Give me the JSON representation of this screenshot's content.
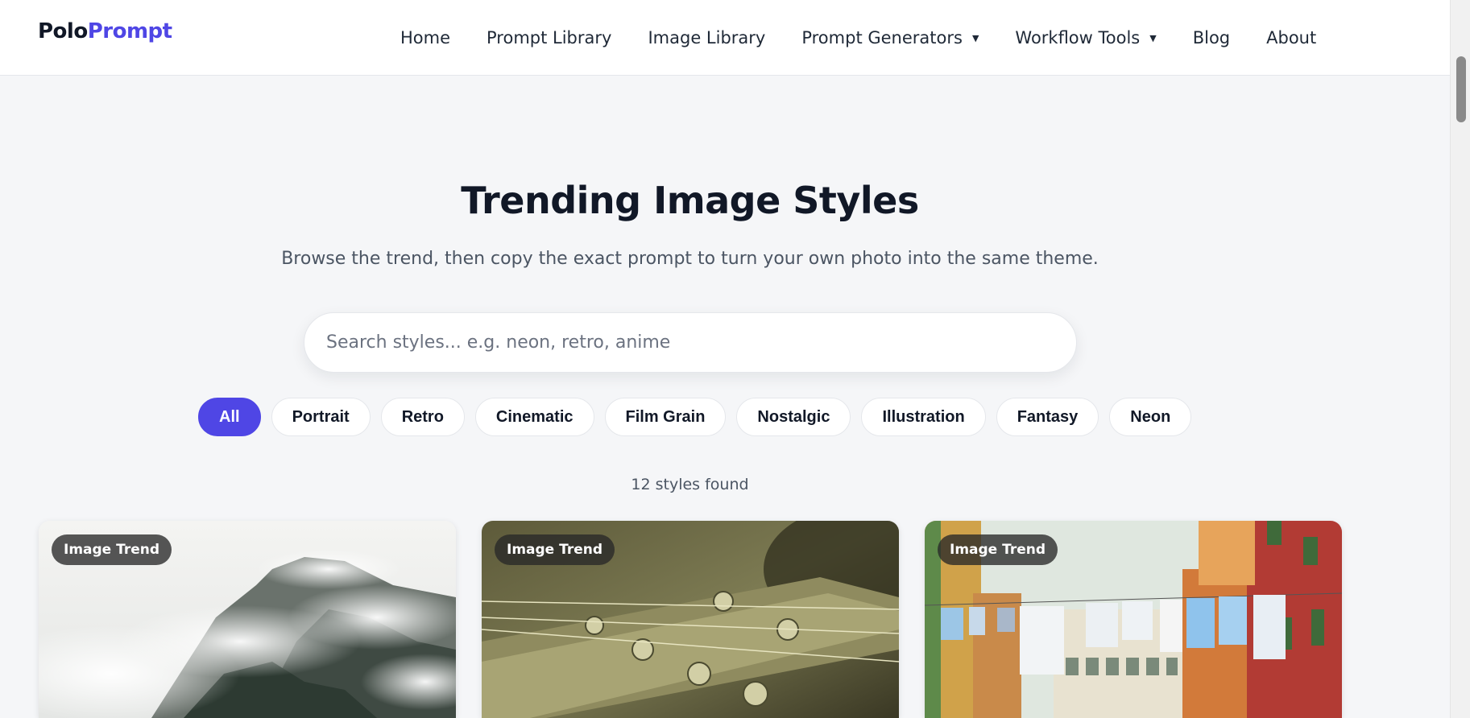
{
  "brand": {
    "part1": "Polo",
    "part2": "Prompt"
  },
  "nav": [
    {
      "label": "Home",
      "dropdown": false
    },
    {
      "label": "Prompt Library",
      "dropdown": false
    },
    {
      "label": "Image Library",
      "dropdown": false
    },
    {
      "label": "Prompt Generators",
      "dropdown": true
    },
    {
      "label": "Workflow Tools",
      "dropdown": true
    },
    {
      "label": "Blog",
      "dropdown": false
    },
    {
      "label": "About",
      "dropdown": false
    }
  ],
  "hero": {
    "title": "Trending Image Styles",
    "subtitle": "Browse the trend, then copy the exact prompt to turn your own photo into the same theme."
  },
  "search": {
    "placeholder": "Search styles... e.g. neon, retro, anime",
    "value": ""
  },
  "filters": [
    "All",
    "Portrait",
    "Retro",
    "Cinematic",
    "Film Grain",
    "Nostalgic",
    "Illustration",
    "Fantasy",
    "Neon"
  ],
  "active_filter": "All",
  "results_count": "12 styles found",
  "cards": [
    {
      "badge": "Image Trend",
      "image": "misty-mountain"
    },
    {
      "badge": "Image Trend",
      "image": "guitar-headstock-sepia"
    },
    {
      "badge": "Image Trend",
      "image": "venice-laundry-street"
    }
  ],
  "colors": {
    "accent": "#4f46e5",
    "background": "#f5f6f8",
    "text": "#111827"
  }
}
